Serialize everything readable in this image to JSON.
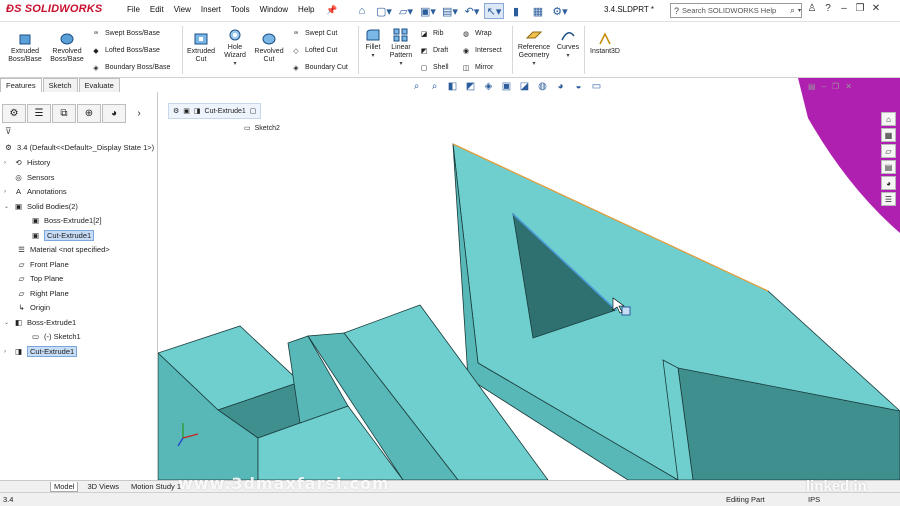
{
  "titlebar": {
    "app_name": "SOLIDWORKS",
    "brand_color": "#c8102e",
    "menu": [
      "File",
      "Edit",
      "View",
      "Insert",
      "Tools",
      "Window",
      "Help"
    ],
    "document_title": "3.4.SLDPRT *",
    "search_placeholder": "Search SOLIDWORKS Help",
    "quick_icons": [
      "home-icon",
      "new-icon",
      "open-icon",
      "save-icon",
      "print-icon",
      "undo-icon",
      "select-icon",
      "rebuild-icon",
      "file-props-icon",
      "options-icon"
    ]
  },
  "ribbon": {
    "extruded_boss": "Extruded Boss/Base",
    "revolved_boss": "Revolved Boss/Base",
    "swept_boss": "Swept Boss/Base",
    "lofted_boss": "Lofted Boss/Base",
    "boundary_boss": "Boundary Boss/Base",
    "extruded_cut": "Extruded Cut",
    "hole_wizard": "Hole Wizard",
    "revolved_cut": "Revolved Cut",
    "swept_cut": "Swept Cut",
    "lofted_cut": "Lofted Cut",
    "boundary_cut": "Boundary Cut",
    "fillet": "Fillet",
    "linear_pattern": "Linear Pattern",
    "rib": "Rib",
    "draft": "Draft",
    "shell": "Shell",
    "wrap": "Wrap",
    "intersect": "Intersect",
    "mirror": "Mirror",
    "reference_geometry": "Reference Geometry",
    "curves": "Curves",
    "instant3d": "Instant3D"
  },
  "command_tabs": [
    "Features",
    "Sketch",
    "Evaluate"
  ],
  "active_tab": "Features",
  "feature_tree": {
    "root": "3.4  (Default<<Default>_Display State 1>)",
    "items": [
      {
        "label": "History",
        "icon": "history-icon"
      },
      {
        "label": "Sensors",
        "icon": "sensor-icon"
      },
      {
        "label": "Annotations",
        "icon": "annotation-icon"
      },
      {
        "label": "Solid Bodies(2)",
        "icon": "solid-bodies-icon"
      },
      {
        "label": "Boss-Extrude1[2]",
        "icon": "body-icon"
      },
      {
        "label": "Cut-Extrude1",
        "icon": "body-icon"
      },
      {
        "label": "Material <not specified>",
        "icon": "material-icon"
      },
      {
        "label": "Front Plane",
        "icon": "plane-icon"
      },
      {
        "label": "Top Plane",
        "icon": "plane-icon"
      },
      {
        "label": "Right Plane",
        "icon": "plane-icon"
      },
      {
        "label": "Origin",
        "icon": "origin-icon"
      },
      {
        "label": "Boss-Extrude1",
        "icon": "boss-extrude-icon"
      },
      {
        "label": "(-) Sketch1",
        "icon": "sketch-icon"
      },
      {
        "label": "Cut-Extrude1",
        "icon": "cut-extrude-icon"
      }
    ]
  },
  "breadcrumb": {
    "feature": "Cut-Extrude1",
    "sketch": "Sketch2"
  },
  "bottom_tabs": [
    "Model",
    "3D Views",
    "Motion Study 1"
  ],
  "active_bottom_tab": "Model",
  "watermark": "www.3dmaxfarsi.com",
  "linkedin": "linked in",
  "status": {
    "left": "3.4",
    "mode": "Editing Part",
    "units": "IPS"
  },
  "colors": {
    "part_face": "#6fcfcf",
    "part_face_dark": "#3f8f8f",
    "part_face_shadow": "#2f7070",
    "edge": "#1a3a3a",
    "highlight_edge": "#e0a040",
    "magenta_body": "#b020b0",
    "selection_blue": "#c7dcf5"
  }
}
